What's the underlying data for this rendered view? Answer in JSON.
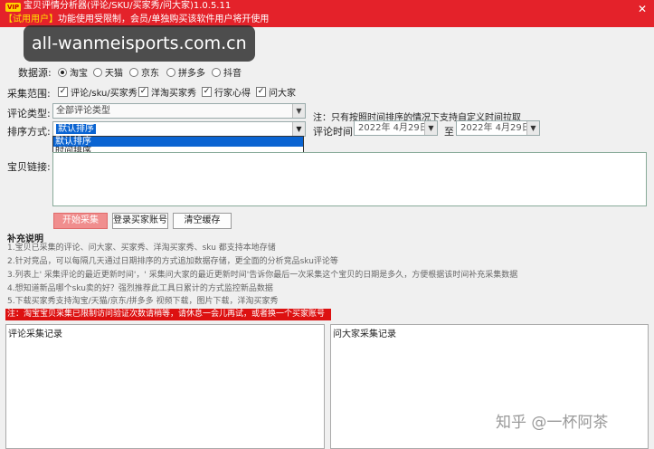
{
  "titlebar": {
    "vip_badge": "VIP",
    "title": "宝贝评情分析器(评论/SKU/买家秀/问大家)1.0.5.11",
    "notice_tag": "【试用用户】",
    "notice_text": "功能使用受限制，会员/单独购买该软件用户将开使用",
    "close": "✕"
  },
  "watermark": {
    "site": "all-wanmeisports.com.cn",
    "zhihu": "知乎 @一杯阿茶"
  },
  "datasource": {
    "label": "数据源:",
    "options": [
      {
        "label": "淘宝",
        "selected": true
      },
      {
        "label": "天猫",
        "selected": false
      },
      {
        "label": "京东",
        "selected": false
      },
      {
        "label": "拼多多",
        "selected": false
      },
      {
        "label": "抖音",
        "selected": false
      }
    ]
  },
  "scope": {
    "label": "采集范围:",
    "options": [
      {
        "label": "评论/sku/买家秀",
        "checked": true
      },
      {
        "label": "洋淘买家秀",
        "checked": true
      },
      {
        "label": "行家心得",
        "checked": true
      },
      {
        "label": "问大家",
        "checked": true
      }
    ]
  },
  "review_type": {
    "label": "评论类型:",
    "value": "全部评论类型",
    "hint": "注：只有按照时间排序的情况下支持自定义时间拉取"
  },
  "sort": {
    "label": "排序方式:",
    "value": "默认排序",
    "options": [
      "默认排序",
      "时间排序"
    ]
  },
  "review_time": {
    "label": "评论时间:",
    "from": "2022年 4月29日",
    "to_label": "至",
    "to": "2022年 4月29日"
  },
  "link": {
    "label": "宝贝链接:"
  },
  "buttons": {
    "start": "开始采集",
    "login": "登录买家账号",
    "clear": "清空缓存"
  },
  "notes": {
    "title": "补充说明",
    "lines": [
      "1.宝贝已采集的评论、问大家、买家秀、洋淘买家秀、sku 都支持本地存储",
      "2.针对竞品，可以每隔几天通过日期排序的方式追加数据存储，更全面的分析竞品sku评论等",
      "3.列表上' 采集评论的最近更新时间'，' 采集问大家的最近更新时间'告诉你最后一次采集这个宝贝的日期是多久，方便根据该时间补充采集数据",
      "4.想知道新品哪个sku卖的好？强烈推荐此工具日累计的方式监控新品数据",
      "5.下载买家秀支持淘宝/天猫/京东/拼多多 视频下载，图片下载，洋淘买家秀"
    ],
    "warning": "注：淘宝宝贝采集已限制访问验证次数请稍等，请休息一会儿再试，或者换一个买家账号"
  },
  "panels": {
    "reviews": "评论采集记录",
    "qa": "问大家采集记录"
  }
}
